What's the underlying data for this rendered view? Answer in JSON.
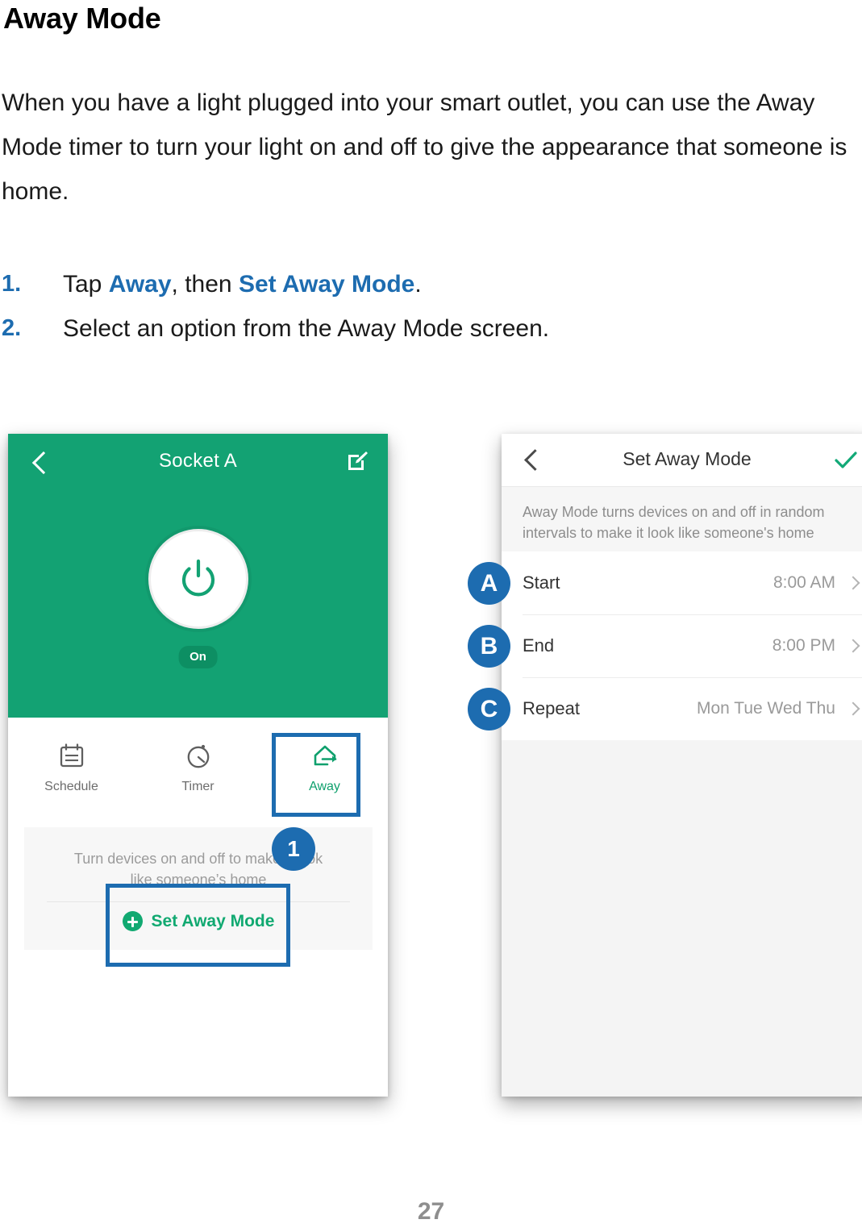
{
  "document": {
    "title": "Away Mode",
    "paragraph": "When you have a light plugged into your smart outlet, you can use the Away Mode timer to turn your light on and off to give the appearance that someone is home.",
    "page_number": "27",
    "accent_blue": "#1d6cb0",
    "accent_green": "#13a273",
    "steps": [
      {
        "number": "1.",
        "prefix": "Tap ",
        "bold1": "Away",
        "middle": ", then ",
        "bold2": "Set Away Mode",
        "suffix": "."
      },
      {
        "number": "2.",
        "prefix": "Select an option from the Away Mode screen.",
        "bold1": "",
        "middle": "",
        "bold2": "",
        "suffix": ""
      }
    ]
  },
  "left_screen": {
    "nav": {
      "back_icon": "chevron-left-icon",
      "title": "Socket A",
      "edit_icon": "edit-square-icon"
    },
    "power": {
      "icon": "power-icon",
      "state_label": "On"
    },
    "tabs": [
      {
        "label": "Schedule",
        "icon": "calendar-icon",
        "active": false
      },
      {
        "label": "Timer",
        "icon": "stopwatch-icon",
        "active": false
      },
      {
        "label": "Away",
        "icon": "house-exit-icon",
        "active": true
      }
    ],
    "away_card": {
      "description_line1": "Turn devices on and off to make it look",
      "description_line2": "like someone’s home",
      "cta_label": "Set Away Mode",
      "cta_icon": "plus-circle-icon"
    },
    "callout": {
      "badge_1": "1"
    }
  },
  "right_screen": {
    "nav": {
      "back_icon": "chevron-left-icon",
      "title": "Set Away Mode",
      "confirm_icon": "check-icon"
    },
    "note": "Away Mode turns devices on and off in random intervals to make it look like someone's home",
    "rows": [
      {
        "badge": "A",
        "label": "Start",
        "value": "8:00 AM"
      },
      {
        "badge": "B",
        "label": "End",
        "value": "8:00 PM"
      },
      {
        "badge": "C",
        "label": "Repeat",
        "value": "Mon Tue Wed Thu"
      }
    ]
  }
}
